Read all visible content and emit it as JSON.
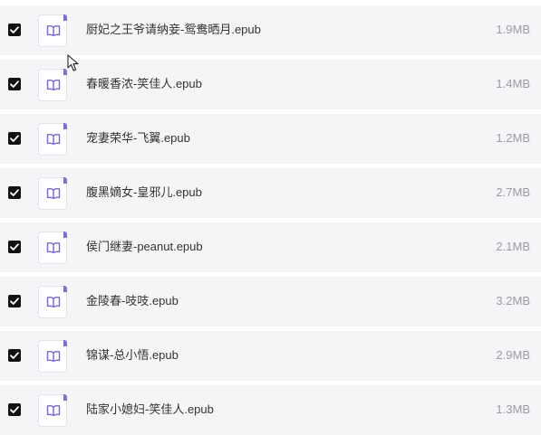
{
  "icons": {
    "checkbox": "checkbox-checked-icon",
    "file": "book-icon",
    "cursor": "mouse-pointer-icon"
  },
  "colors": {
    "row_background": "#f5f5f8",
    "checkbox_fill": "#111111",
    "file_icon_accent": "#7c6fd6",
    "name_text": "#333333",
    "size_text": "#9a9aa2"
  },
  "files": [
    {
      "name": "厨妃之王爷请纳妾-鸳鸯晒月.epub",
      "size": "1.9MB",
      "checked": true
    },
    {
      "name": "春暖香浓-笑佳人.epub",
      "size": "1.4MB",
      "checked": true
    },
    {
      "name": "宠妻荣华-飞翼.epub",
      "size": "1.2MB",
      "checked": true
    },
    {
      "name": "腹黑嫡女-皇邪儿.epub",
      "size": "2.7MB",
      "checked": true
    },
    {
      "name": "侯门继妻-peanut.epub",
      "size": "2.1MB",
      "checked": true
    },
    {
      "name": "金陵春-吱吱.epub",
      "size": "3.2MB",
      "checked": true
    },
    {
      "name": "锦谋-总小悟.epub",
      "size": "2.9MB",
      "checked": true
    },
    {
      "name": "陆家小媳妇-笑佳人.epub",
      "size": "1.3MB",
      "checked": true
    }
  ]
}
